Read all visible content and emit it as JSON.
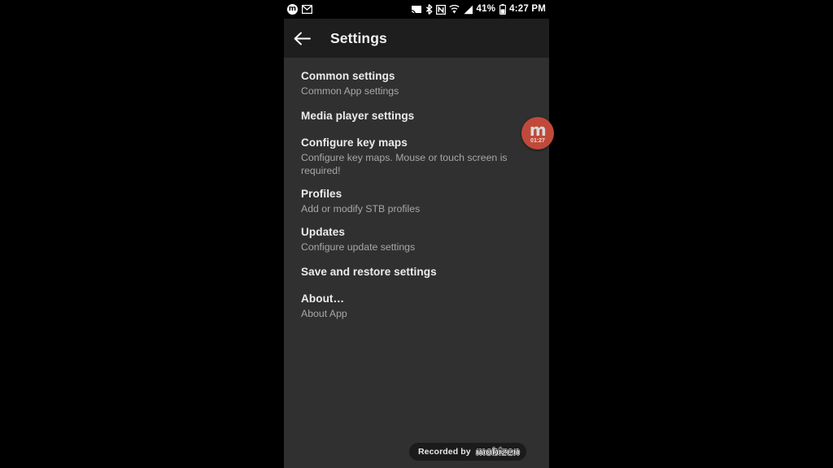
{
  "status_bar": {
    "left_icons": [
      {
        "name": "mobizen-notification-icon",
        "glyph": "m"
      },
      {
        "name": "gmail-icon",
        "glyph": "✉"
      }
    ],
    "right_icons": [
      {
        "name": "cast-icon"
      },
      {
        "name": "bluetooth-icon"
      },
      {
        "name": "nfc-icon"
      },
      {
        "name": "wifi-icon"
      },
      {
        "name": "cellular-signal-icon"
      }
    ],
    "battery_percent": "41%",
    "clock": "4:27 PM"
  },
  "toolbar": {
    "back_label": "←",
    "title": "Settings"
  },
  "settings_list": [
    {
      "title": "Common settings",
      "summary": "Common App settings",
      "name": "common-settings"
    },
    {
      "title": "Media player settings",
      "summary": "",
      "name": "media-player-settings"
    },
    {
      "title": "Configure key maps",
      "summary": "Configure key maps. Mouse or touch screen is required!",
      "name": "configure-key-maps"
    },
    {
      "title": "Profiles",
      "summary": "Add or modify STB profiles",
      "name": "profiles"
    },
    {
      "title": "Updates",
      "summary": "Configure update settings",
      "name": "updates"
    },
    {
      "title": "Save and restore settings",
      "summary": "",
      "name": "save-and-restore-settings"
    },
    {
      "title": "About…",
      "summary": "About App",
      "name": "about"
    }
  ],
  "mobizen_bubble": {
    "logo": "m",
    "timer": "01:27",
    "color": "#c0493a"
  },
  "watermark": {
    "prefix": "Recorded by",
    "logo": "mobizen"
  },
  "colors": {
    "letterbox": "#000000",
    "status_bar": "#000000",
    "toolbar": "#1e1e1e",
    "content": "#303030",
    "title_text": "#ebebeb",
    "summary_text": "#a7a7a7"
  }
}
